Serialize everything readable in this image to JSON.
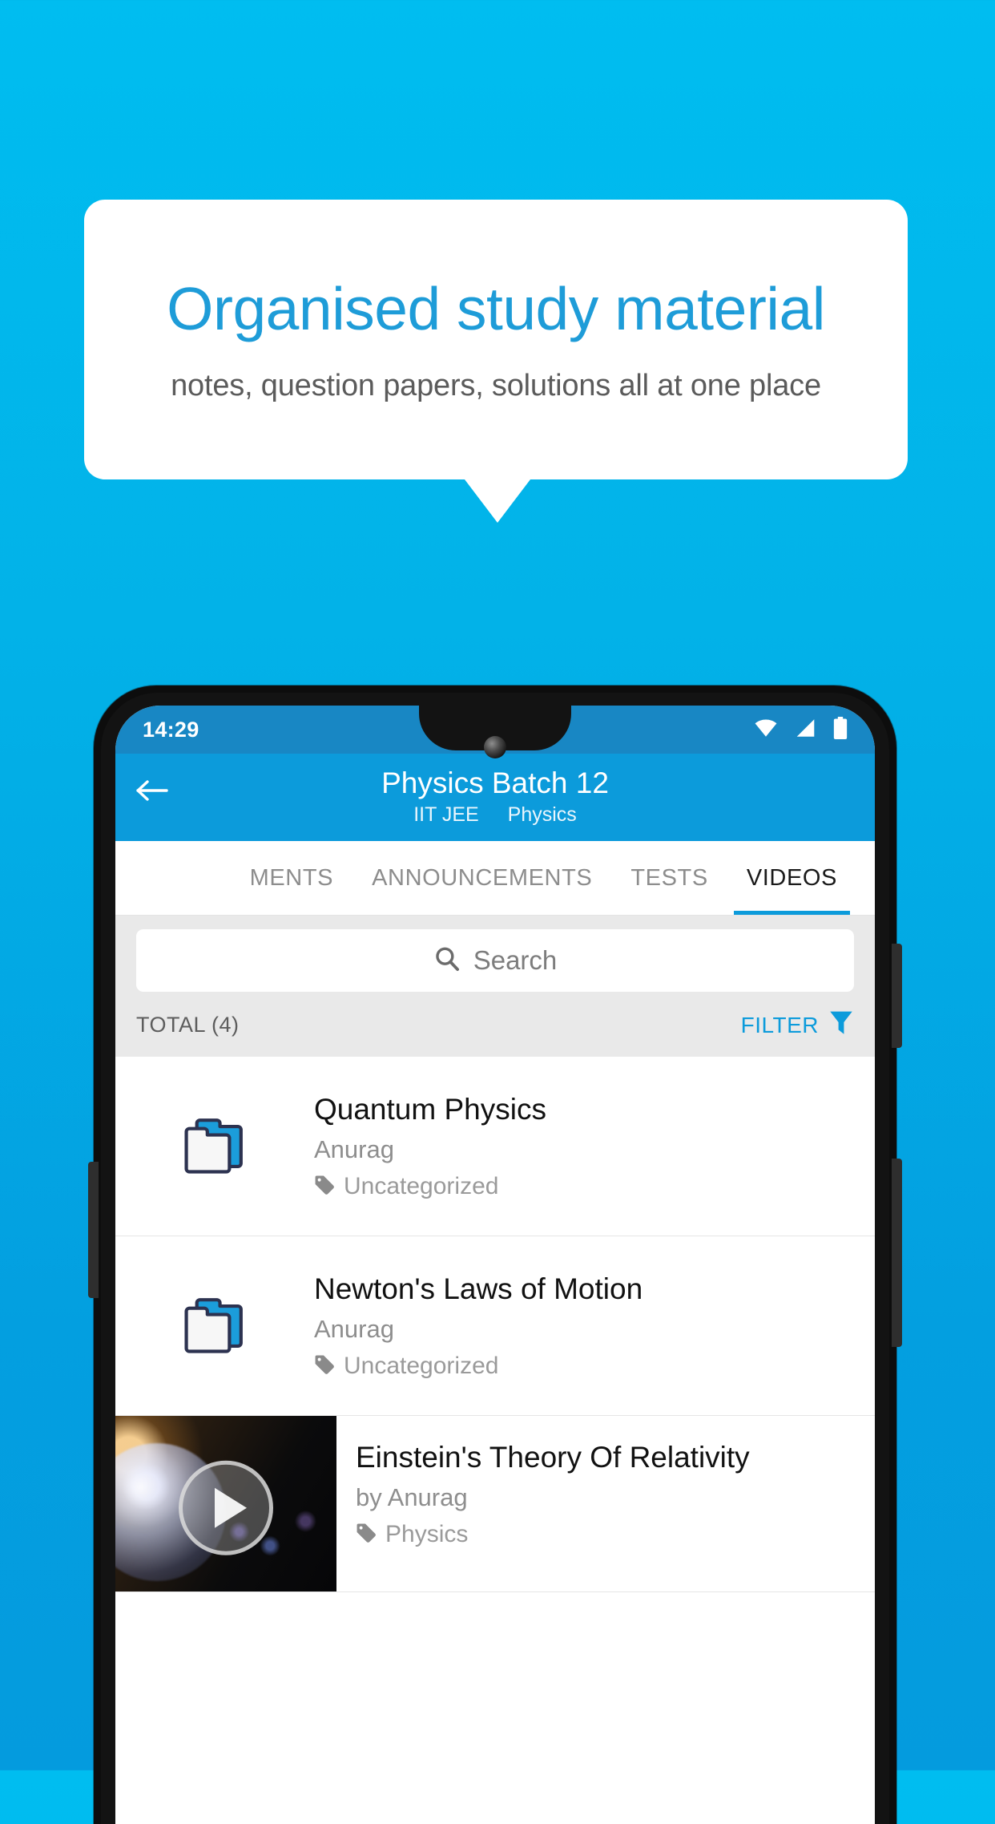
{
  "promo": {
    "title": "Organised study material",
    "subtitle": "notes, question papers, solutions all at one place",
    "title_color": "#1e9cd8",
    "background_top": "#00bdf0",
    "background_bottom": "#049bde"
  },
  "phone": {
    "status_bar": {
      "time": "14:29",
      "icons": [
        "wifi-icon",
        "signal-icon",
        "battery-icon"
      ],
      "background": "#1887c4"
    },
    "app_bar": {
      "back_icon": "back-arrow-icon",
      "title": "Physics Batch 12",
      "subtitle_left": "IIT JEE",
      "subtitle_right": "Physics",
      "background": "#0c9bdb"
    },
    "tabs": [
      {
        "label": "MENTS",
        "active": false,
        "clipped": true
      },
      {
        "label": "ANNOUNCEMENTS",
        "active": false,
        "clipped": false
      },
      {
        "label": "TESTS",
        "active": false,
        "clipped": false
      },
      {
        "label": "VIDEOS",
        "active": true,
        "clipped": false
      }
    ],
    "search": {
      "placeholder": "Search",
      "value": "",
      "icon": "search-icon"
    },
    "toolbar": {
      "total_label": "TOTAL (4)",
      "filter_label": "FILTER",
      "filter_icon": "funnel-icon",
      "accent_color": "#0c9bdb"
    },
    "list": [
      {
        "type": "folder",
        "icon": "folder-icon",
        "title": "Quantum Physics",
        "author": "Anurag",
        "tag_icon": "tag-icon",
        "tag": "Uncategorized"
      },
      {
        "type": "folder",
        "icon": "folder-icon",
        "title": "Newton's Laws of Motion",
        "author": "Anurag",
        "tag_icon": "tag-icon",
        "tag": "Uncategorized"
      },
      {
        "type": "video",
        "icon": "play-icon",
        "title": "Einstein's Theory Of Relativity",
        "author": "by Anurag",
        "tag_icon": "tag-icon",
        "tag": "Physics"
      }
    ]
  }
}
